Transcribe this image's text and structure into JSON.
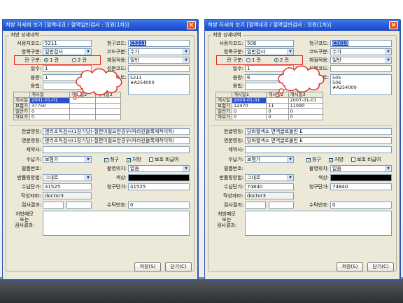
{
  "windows": [
    {
      "id": "left",
      "title": "처방 자세히 보기 [혈액내과 / 혈액일반검사 : 의원(1차)]",
      "group_label": "처방 상세내역",
      "labels": {
        "user_code": "사용자코드:",
        "category": "항목구분:",
        "ran_type": "란 구분:",
        "days": "일수:",
        "dose": "용량:",
        "usage": "용법:",
        "claim_code": "청구코드:",
        "code_type": "코드구분:",
        "method": "채점적용:",
        "ingredient": "성분코드:",
        "rx_list": "처방리스트:",
        "kor_name": "한글명칭:",
        "eng_name": "영문명칭:",
        "maker": "제약사:",
        "payment": "수납가:",
        "film": "필름번호:",
        "return": "반품링방법:",
        "unit_price": "수납단가:",
        "author": "작성자ID:",
        "result": "검사결과:",
        "shoot_pos": "촬영위치:",
        "color": "색상:",
        "claim_price": "청구단가:",
        "receipt_no": "수탁번호:",
        "memo": "처방메모\n또는\n검사결과:"
      },
      "values": {
        "user_code": "5211",
        "claim_code": "C5211",
        "category": "일반검사",
        "code_type": "수가",
        "ran_option1": "1 란",
        "ran_option2": "2 란",
        "method": "일반",
        "days": "1",
        "ingredient": "",
        "dose": "1",
        "usage": "",
        "rx_list_1": "5211",
        "rx_list_2": "#A254000",
        "kor_name": "병리조직검사(1장기당)-절편이필요한경우(파라핀블록제작이하)",
        "eng_name": "병리조직검사(1장기당)-절편이필요한경우(파라핀블록제작이하)",
        "maker": "",
        "payment": "보험가",
        "check_claim": "청구",
        "check_rx": "처방",
        "check_keep": "보호 비급여",
        "film": "",
        "shoot_pos": "없음",
        "return": "그대로",
        "unit_price": "41525",
        "claim_price": "41525",
        "author": "doctor3",
        "result_a": "",
        "result_b": "",
        "receipt_no": "0",
        "memo": ""
      },
      "grid": {
        "headers": [
          "",
          "개시일",
          "개시일2",
          "개시일3"
        ],
        "rows": [
          [
            "개시일",
            "2001-01-01",
            "",
            ""
          ],
          [
            "보험가",
            "37750",
            "",
            ""
          ],
          [
            "일반가",
            "0",
            "",
            ""
          ],
          [
            "자보가",
            "0",
            "",
            ""
          ]
        ]
      },
      "buttons": {
        "save": "저장(S)",
        "close": "닫기(C)"
      }
    },
    {
      "id": "right",
      "title": "처방 자세히 보기 [혈액내과 / 혈액일반검사 : 의원(1차)]",
      "group_label": "처방 상세내역",
      "labels": {
        "user_code": "사용자코드:",
        "category": "항목구분:",
        "ran_type": "란 구분:",
        "days": "일수:",
        "dose": "용량:",
        "usage": "용법:",
        "claim_code": "청구코드:",
        "code_type": "코드구분:",
        "method": "채점적용:",
        "ingredient": "성분코드:",
        "rx_list": "리스트:",
        "kor_name": "한글명칭:",
        "eng_name": "영문명칭:",
        "maker": "제약사:",
        "payment": "수납가:",
        "film": "필름번호:",
        "return": "반품링방법:",
        "unit_price": "수납단가:",
        "author": "작성자ID:",
        "result": "검사결과:",
        "shoot_pos": "촬영위치:",
        "color": "색상:",
        "claim_price": "청구단가:",
        "receipt_no": "수탁번호:",
        "memo": "처방메모\n또는\n검사결과:"
      },
      "values": {
        "user_code": "506",
        "claim_code": "C5010",
        "category": "일반검사",
        "code_type": "수가",
        "ran_option1": "1 란",
        "ran_option2": "2 란",
        "method": "일반",
        "days": "1",
        "ingredient": "",
        "dose": "6",
        "usage": "",
        "rx_list_1": "505",
        "rx_list_2": "506",
        "rx_list_3": "#A254000",
        "kor_name": "당화혈색소 면역글로불린 E",
        "eng_name": "당화혈색소 면역글로불린 E",
        "maker": "",
        "payment": "보험가",
        "check_claim": "청구",
        "check_rx": "처방",
        "check_keep": "보호 비급여",
        "film": "",
        "shoot_pos": "없음",
        "return": "그대로",
        "unit_price": "74840",
        "claim_price": "74840",
        "author": "doctor3",
        "result_a": "",
        "result_b": "",
        "receipt_no": "0",
        "memo": ""
      },
      "grid": {
        "headers": [
          "",
          "개시일1",
          "개시일2",
          "개시일3"
        ],
        "rows": [
          [
            "개시일",
            "2009-01-01",
            "",
            "2007-01-01"
          ],
          [
            "보험가",
            "12470",
            "11",
            "11090"
          ],
          [
            "일반가",
            "0",
            "0",
            "0"
          ],
          [
            "자보가",
            "0",
            "0",
            "0"
          ]
        ]
      },
      "buttons": {
        "save": "저장(S)",
        "close": "닫기(C)"
      }
    }
  ],
  "colors": {
    "highlight": "#e0281e",
    "titlebar": "#2a5fdb",
    "selection": "#2b4fcf"
  },
  "icons": {
    "close": "close-icon",
    "dropdown": "chevron-down-icon",
    "annotation": "thought-cloud"
  }
}
